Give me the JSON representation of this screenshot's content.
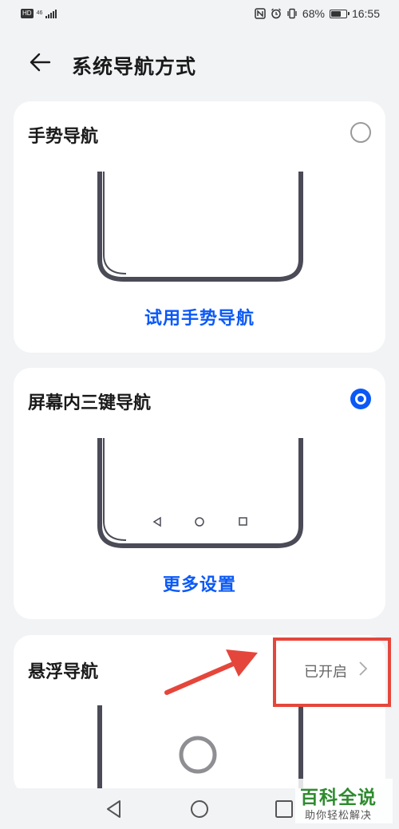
{
  "status_bar": {
    "left_badge": "HD",
    "network": "46",
    "battery_percent": "68%",
    "battery_level": 0.68,
    "time": "16:55"
  },
  "header": {
    "back_icon": "arrow-left-icon",
    "title": "系统导航方式"
  },
  "options": {
    "gesture": {
      "title": "手势导航",
      "selected": false,
      "link": "试用手势导航"
    },
    "three_key": {
      "title": "屏幕内三键导航",
      "selected": true,
      "link": "更多设置"
    },
    "floating": {
      "title": "悬浮导航",
      "status": "已开启"
    }
  },
  "navbar": {
    "icons": [
      "back-triangle-icon",
      "home-circle-icon",
      "recents-square-icon"
    ]
  },
  "watermark": {
    "main": "百科全说",
    "sub": "助你轻松解决"
  },
  "colors": {
    "accent": "#0a59f7",
    "annotation": "#e5463b",
    "background": "#f1f3f5",
    "phone_frame": "#4a4b56"
  }
}
